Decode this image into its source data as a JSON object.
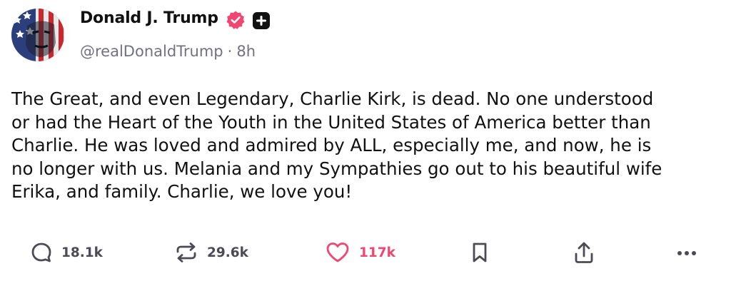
{
  "post": {
    "author": {
      "display_name": "Donald J. Trump",
      "handle": "@realDonaldTrump",
      "separator": "·",
      "time": "8h",
      "verified_icon": "verified-badge-icon",
      "badge_icon": "plus-badge-icon",
      "verified_color": "#f0466f"
    },
    "body_lines": [
      "The Great, and even Legendary, Charlie Kirk, is dead. No one understood",
      "or had the Heart of the Youth in the United States of America better than",
      "Charlie. He was loved and admired by ALL, especially me, and now, he is",
      "no longer with us. Melania and my Sympathies go out to his beautiful wife",
      "Erika, and family. Charlie, we love you!"
    ],
    "actions": {
      "reply": {
        "icon": "reply-icon",
        "count": "18.1k"
      },
      "repost": {
        "icon": "repost-icon",
        "count": "29.6k"
      },
      "like": {
        "icon": "heart-icon",
        "count": "117k",
        "color": "#f0466f"
      },
      "bookmark": {
        "icon": "bookmark-icon"
      },
      "share": {
        "icon": "share-icon"
      },
      "more": {
        "icon": "more-icon"
      }
    }
  }
}
